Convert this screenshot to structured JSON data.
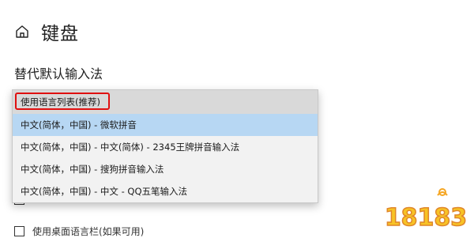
{
  "header": {
    "title": "键盘",
    "icon": "home-icon"
  },
  "section": {
    "title": "替代默认输入法"
  },
  "dropdown": {
    "options": [
      {
        "label": "使用语言列表(推荐)",
        "state": "hover"
      },
      {
        "label": "中文(简体，中国) - 微软拼音",
        "state": "selected"
      },
      {
        "label": "中文(简体，中国) - 中文(简体) - 2345王牌拼音输入法",
        "state": "normal"
      },
      {
        "label": "中文(简体，中国) - 搜狗拼音输入法",
        "state": "normal"
      },
      {
        "label": "中文(简体，中国) - 中文 - QQ五笔输入法",
        "state": "normal"
      }
    ],
    "highlight_color": "#e01010",
    "selected_color": "#b7d7f3"
  },
  "behind": {
    "row1_label": "",
    "row2_label": "使用桌面语言栏(如果可用)"
  },
  "watermark": {
    "text": "18183"
  }
}
